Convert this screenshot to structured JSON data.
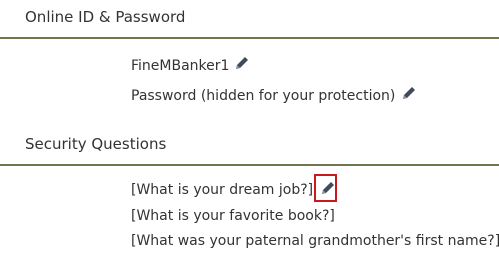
{
  "online_id_section": {
    "title": "Online ID & Password",
    "online_id": "FineMBanker1",
    "password_text": "Password (hidden for your protection)"
  },
  "security_section": {
    "title": "Security Questions",
    "questions": [
      "[What is your dream job?]",
      "[What is your favorite book?]",
      "[What was your paternal grandmother's first name?]"
    ]
  },
  "icons": {
    "edit": "pencil-icon"
  },
  "colors": {
    "divider": "#74754f",
    "text": "#333333",
    "icon": "#3f4a5a",
    "highlight": "#c8191f"
  }
}
